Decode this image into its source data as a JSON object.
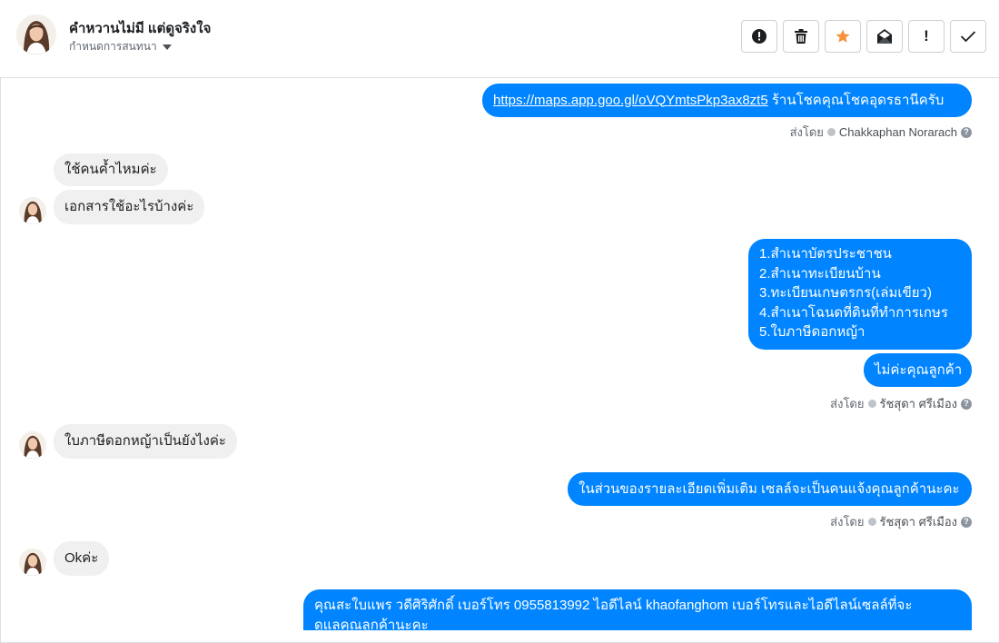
{
  "header": {
    "contact_name": "คำหวานไม่มี แต่ดูจริงใจ",
    "subtitle": "กำหนดการสนทนา",
    "tools": [
      {
        "name": "report-icon"
      },
      {
        "name": "trash-icon"
      },
      {
        "name": "star-icon",
        "color": "#f7923b"
      },
      {
        "name": "mark-unread-icon"
      },
      {
        "name": "exclamation-icon",
        "label": "!"
      },
      {
        "name": "checkmark-icon"
      }
    ]
  },
  "messages": {
    "m1": {
      "link": "https://maps.app.goo.gl/oVQYmtsPkp3ax8zt5",
      "text": " ร้านโชคคุณโชคอุดรธานีครับ"
    },
    "m1_meta": {
      "prefix": "ส่งโดย",
      "sender": "Chakkaphan Norarach",
      "help": "?"
    },
    "m2": "ใช้คนค้ำไหมค่ะ",
    "m3": "เอกสารใช้อะไรบ้างค่ะ",
    "m4": [
      "1.สำเนาบัตรประชาชน",
      "2.สำเนาทะเบียนบ้าน",
      "3.ทะเบียนเกษตรกร(เล่มเขียว)",
      "4.สำเนาโฉนดที่ดินที่ทำการเกษร",
      "5.ใบภาษีดอกหญ้า"
    ],
    "m5": "ไม่ค่ะคุณลูกค้า",
    "m5_meta": {
      "prefix": "ส่งโดย",
      "sender": "รัชสุดา ศรีเมือง",
      "help": "?"
    },
    "m6": "ใบภาษีดอกหญ้าเป็นยังไงค่ะ",
    "m7": "ในส่วนของรายละเอียดเพิ่มเติม  เซลล์จะเป็นคนแจ้งคุณลูกค้านะคะ",
    "m7_meta": {
      "prefix": "ส่งโดย",
      "sender": "รัชสุดา ศรีเมือง",
      "help": "?"
    },
    "m8": "Okค่ะ",
    "m9": [
      "คุณสะใบแพร วดีศิริศักดิ์ เบอร์โทร 0955813992  ไอดีไลน์  khaofanghom   เบอร์โทรและไอดีไลน์เซลล์ที่จะ",
      "ดูแลคุณลูกค้านะคะ"
    ]
  },
  "colors": {
    "outgoing": "#0084ff",
    "incoming": "#f1f0f0",
    "star": "#f7923b"
  }
}
